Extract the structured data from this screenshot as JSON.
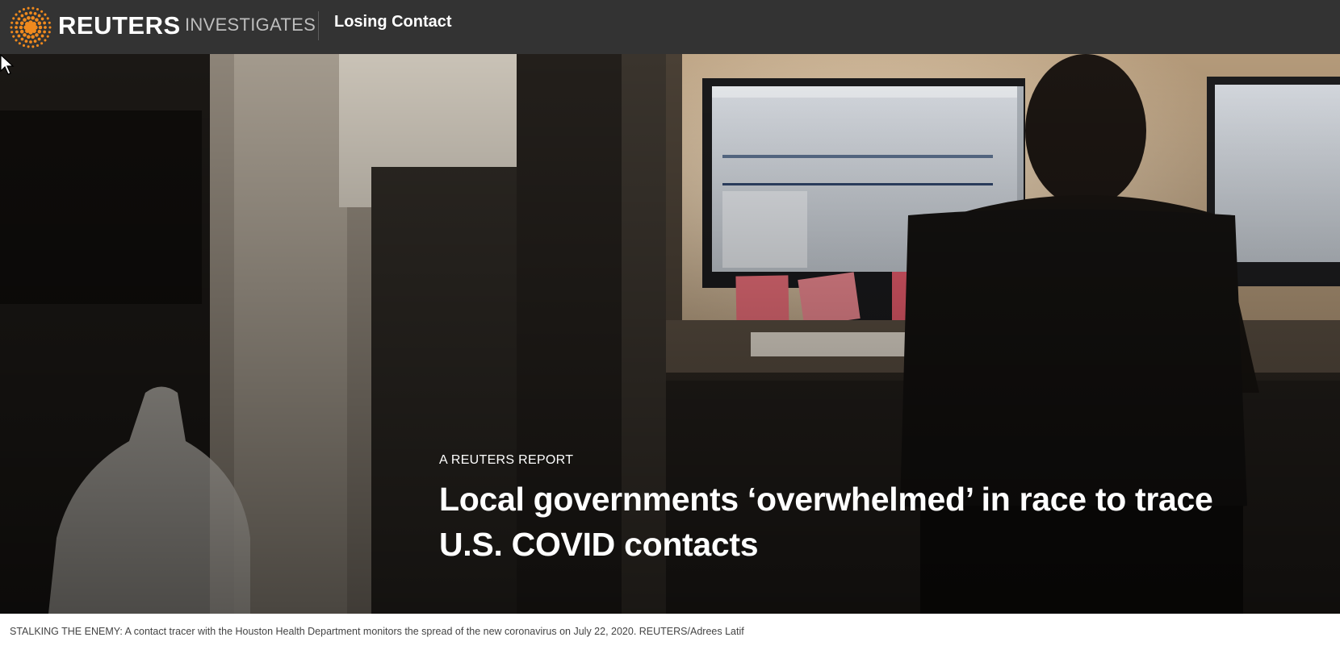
{
  "header": {
    "brand": "REUTERS",
    "brand_sub": "INVESTIGATES",
    "story_title": "Losing Contact",
    "logo_icon": "reuters-dot-logo-icon",
    "background_color": "#333333"
  },
  "hero": {
    "kicker": "A REUTERS REPORT",
    "headline": "Local governments ‘overwhelmed’ in race to trace U.S. COVID contacts",
    "image_description_icon": "contact-tracer-photo"
  },
  "caption": "STALKING THE ENEMY: A contact tracer with the Houston Health Department monitors the spread of the new coronavirus on July 22, 2020. REUTERS/Adrees Latif",
  "colors": {
    "brand_orange": "#f08a1e",
    "text_white": "#ffffff",
    "caption_text": "#444444"
  }
}
